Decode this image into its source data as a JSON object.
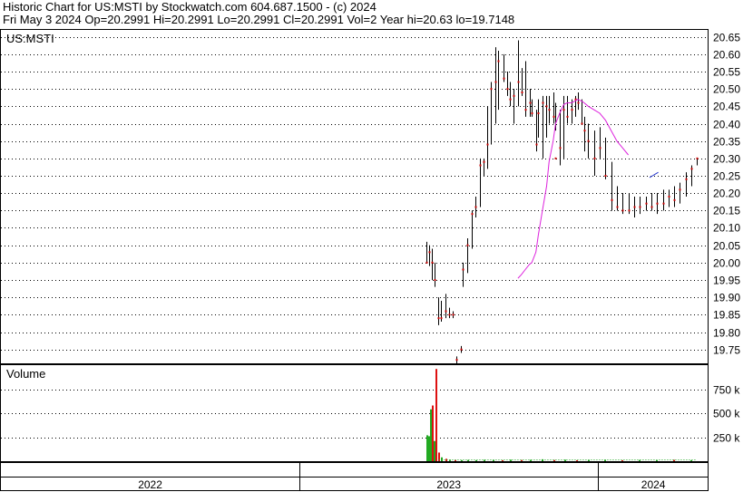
{
  "header": {
    "line1": "Historic Chart for US:MSTI by Stockwatch.com 604.687.1500 - (c) 2024",
    "line2": "Fri May  3 2024   Op=20.2991  Hi=20.2991  Lo=20.2991  Cl=20.2991  Vol=2  Year hi=20.63  lo=19.7148"
  },
  "colors": {
    "price_bar": "#000000",
    "close_dot": "#cc0000",
    "moving_average": "#dd22dd",
    "ma_tail": "#2233cc",
    "volume_up": "#22aa22",
    "volume_down": "#dd1111",
    "frame": "#000000"
  },
  "chart_data": [
    {
      "type": "ohlc",
      "title": "US:MSTI",
      "x": [
        "2023-06-05",
        "2023-06-08",
        "2023-06-12",
        "2023-06-15",
        "2023-06-20",
        "2023-06-23",
        "2023-06-28",
        "2023-07-03",
        "2023-07-07",
        "2023-07-12",
        "2023-07-17",
        "2023-07-20",
        "2023-07-25",
        "2023-07-31",
        "2023-08-04",
        "2023-08-09",
        "2023-08-14",
        "2023-08-18",
        "2023-08-23",
        "2023-08-28",
        "2023-09-01",
        "2023-09-07",
        "2023-09-12",
        "2023-09-15",
        "2023-09-20",
        "2023-09-25",
        "2023-09-29",
        "2023-10-04",
        "2023-10-09",
        "2023-10-12",
        "2023-10-17",
        "2023-10-20",
        "2023-10-25",
        "2023-10-30",
        "2023-11-02",
        "2023-11-07",
        "2023-11-10",
        "2023-11-15",
        "2023-11-20",
        "2023-11-24",
        "2023-11-29",
        "2023-12-04",
        "2023-12-07",
        "2023-12-12",
        "2023-12-15",
        "2023-12-20",
        "2023-12-27",
        "2024-01-03",
        "2024-01-10",
        "2024-01-17",
        "2024-01-24",
        "2024-01-31",
        "2024-02-07",
        "2024-02-14",
        "2024-02-21",
        "2024-02-28",
        "2024-03-06",
        "2024-03-13",
        "2024-03-20",
        "2024-03-27",
        "2024-04-03",
        "2024-04-10",
        "2024-04-17",
        "2024-04-24",
        "2024-05-01"
      ],
      "open": [
        20.0,
        20.04,
        20.03,
        19.95,
        19.88,
        19.85,
        19.88,
        19.85,
        19.85,
        19.72,
        19.75,
        19.95,
        19.98,
        20.05,
        20.14,
        20.17,
        20.27,
        20.28,
        20.35,
        20.45,
        20.52,
        20.58,
        20.52,
        20.48,
        20.45,
        20.5,
        20.52,
        20.45,
        20.46,
        20.44,
        20.35,
        20.4,
        20.42,
        20.44,
        20.46,
        20.44,
        20.42,
        20.3,
        20.33,
        20.45,
        20.42,
        20.44,
        20.47,
        20.45,
        20.4,
        20.38,
        20.34,
        20.35,
        20.32,
        20.25,
        20.18,
        20.15,
        20.16,
        20.15,
        20.16,
        20.16,
        20.17,
        20.16,
        20.18,
        20.17,
        20.19,
        20.2,
        20.22,
        20.25,
        20.3
      ],
      "high": [
        20.06,
        20.05,
        20.04,
        20.0,
        19.9,
        19.89,
        19.91,
        19.87,
        19.86,
        19.73,
        19.76,
        20.0,
        20.07,
        20.15,
        20.19,
        20.3,
        20.3,
        20.45,
        20.52,
        20.62,
        20.61,
        20.6,
        20.55,
        20.52,
        20.5,
        20.64,
        20.56,
        20.58,
        20.5,
        20.47,
        20.44,
        20.47,
        20.48,
        20.48,
        20.48,
        20.49,
        20.46,
        20.44,
        20.48,
        20.48,
        20.47,
        20.48,
        20.49,
        20.47,
        20.42,
        20.4,
        20.38,
        20.39,
        20.36,
        20.29,
        20.22,
        20.2,
        20.2,
        20.19,
        20.19,
        20.19,
        20.2,
        20.2,
        20.21,
        20.21,
        20.22,
        20.23,
        20.26,
        20.28,
        20.3
      ],
      "low": [
        20.0,
        19.99,
        19.95,
        19.93,
        19.82,
        19.83,
        19.84,
        19.84,
        19.84,
        19.71,
        19.74,
        19.93,
        19.97,
        20.04,
        20.13,
        20.16,
        20.25,
        20.27,
        20.34,
        20.4,
        20.44,
        20.52,
        20.48,
        20.45,
        20.4,
        20.45,
        20.48,
        20.42,
        20.42,
        20.42,
        20.32,
        20.36,
        20.3,
        20.36,
        20.4,
        20.4,
        20.38,
        20.28,
        20.3,
        20.4,
        20.4,
        20.42,
        20.44,
        20.4,
        20.32,
        20.3,
        20.25,
        20.3,
        20.24,
        20.15,
        20.15,
        20.14,
        20.14,
        20.13,
        20.14,
        20.15,
        20.15,
        20.14,
        20.15,
        20.16,
        20.16,
        20.17,
        20.19,
        20.22,
        20.28
      ],
      "close": [
        20.0,
        20.03,
        20.0,
        19.95,
        19.84,
        19.84,
        19.86,
        19.85,
        19.85,
        19.72,
        19.75,
        19.98,
        20.05,
        20.14,
        20.16,
        20.28,
        20.29,
        20.34,
        20.5,
        20.52,
        20.58,
        20.53,
        20.5,
        20.47,
        20.48,
        20.52,
        20.49,
        20.44,
        20.46,
        20.43,
        20.34,
        20.43,
        20.46,
        20.45,
        20.44,
        20.42,
        20.3,
        20.33,
        20.44,
        20.42,
        20.44,
        20.47,
        20.46,
        20.4,
        20.38,
        20.35,
        20.3,
        20.33,
        20.25,
        20.18,
        20.16,
        20.15,
        20.15,
        20.16,
        20.16,
        20.17,
        20.16,
        20.17,
        20.17,
        20.19,
        20.18,
        20.21,
        20.24,
        20.27,
        20.3
      ],
      "moving_average": [
        [
          25,
          19.955
        ],
        [
          26,
          19.965
        ],
        [
          27,
          19.98
        ],
        [
          28,
          19.995
        ],
        [
          29,
          20.0
        ],
        [
          30,
          20.03
        ],
        [
          31,
          20.08
        ],
        [
          32,
          20.15
        ],
        [
          33,
          20.22
        ],
        [
          34,
          20.29
        ],
        [
          35,
          20.35
        ],
        [
          36,
          20.4
        ],
        [
          37,
          20.43
        ],
        [
          38,
          20.455
        ],
        [
          39,
          20.46
        ],
        [
          40,
          20.46
        ],
        [
          41,
          20.465
        ],
        [
          42,
          20.47
        ],
        [
          43,
          20.465
        ],
        [
          44,
          20.46
        ],
        [
          45,
          20.45
        ],
        [
          46,
          20.44
        ],
        [
          47,
          20.43
        ],
        [
          48,
          20.41
        ],
        [
          49,
          20.38
        ],
        [
          50,
          20.35
        ],
        [
          51,
          20.33
        ],
        [
          52,
          20.31
        ]
      ],
      "ma_tail": [
        [
          52,
          20.245
        ],
        [
          53,
          20.25
        ],
        [
          54,
          20.255
        ],
        [
          55,
          20.26
        ]
      ],
      "ylim": [
        19.71,
        20.67
      ],
      "yticks": [
        "20.65",
        "20.60",
        "20.55",
        "20.50",
        "20.45",
        "20.40",
        "20.35",
        "20.30",
        "20.25",
        "20.20",
        "20.15",
        "20.10",
        "20.05",
        "20.00",
        "19.95",
        "19.90",
        "19.85",
        "19.80",
        "19.75"
      ],
      "grid": true
    },
    {
      "type": "bar",
      "title": "Volume",
      "ylim": [
        0,
        1000000
      ],
      "yticks": [
        "750 k",
        "500 k",
        "250 k"
      ],
      "bars": [
        {
          "x": "2023-06-05",
          "v": 270000,
          "dir": "up"
        },
        {
          "x": "2023-06-07",
          "v": 260000,
          "dir": "up"
        },
        {
          "x": "2023-06-09",
          "v": 540000,
          "dir": "up"
        },
        {
          "x": "2023-06-12",
          "v": 580000,
          "dir": "down"
        },
        {
          "x": "2023-06-14",
          "v": 210000,
          "dir": "up"
        },
        {
          "x": "2023-06-16",
          "v": 960000,
          "dir": "down"
        },
        {
          "x": "2023-06-20",
          "v": 90000,
          "dir": "down"
        },
        {
          "x": "2023-06-23",
          "v": 40000,
          "dir": "up"
        },
        {
          "x": "2023-06-28",
          "v": 25000,
          "dir": "down"
        },
        {
          "x": "2023-07-03",
          "v": 15000,
          "dir": "up"
        },
        {
          "x": "2023-07-10",
          "v": 12000,
          "dir": "down"
        },
        {
          "x": "2023-07-17",
          "v": 10000,
          "dir": "up"
        },
        {
          "x": "2023-07-25",
          "v": 12000,
          "dir": "up"
        },
        {
          "x": "2023-08-04",
          "v": 10000,
          "dir": "up"
        },
        {
          "x": "2023-08-14",
          "v": 14000,
          "dir": "up"
        },
        {
          "x": "2023-08-25",
          "v": 12000,
          "dir": "up"
        },
        {
          "x": "2023-09-05",
          "v": 10000,
          "dir": "down"
        },
        {
          "x": "2023-09-15",
          "v": 15000,
          "dir": "up"
        },
        {
          "x": "2023-09-28",
          "v": 12000,
          "dir": "down"
        },
        {
          "x": "2023-10-10",
          "v": 14000,
          "dir": "up"
        },
        {
          "x": "2023-10-24",
          "v": 20000,
          "dir": "up"
        },
        {
          "x": "2023-11-07",
          "v": 12000,
          "dir": "down"
        },
        {
          "x": "2023-11-21",
          "v": 15000,
          "dir": "up"
        },
        {
          "x": "2023-12-05",
          "v": 10000,
          "dir": "down"
        },
        {
          "x": "2023-12-19",
          "v": 12000,
          "dir": "up"
        },
        {
          "x": "2024-01-09",
          "v": 14000,
          "dir": "up"
        },
        {
          "x": "2024-01-30",
          "v": 10000,
          "dir": "down"
        },
        {
          "x": "2024-02-20",
          "v": 12000,
          "dir": "up"
        },
        {
          "x": "2024-03-12",
          "v": 10000,
          "dir": "up"
        },
        {
          "x": "2024-04-02",
          "v": 14000,
          "dir": "down"
        },
        {
          "x": "2024-04-23",
          "v": 10000,
          "dir": "up"
        }
      ]
    }
  ],
  "time_axis": {
    "years": [
      "2022",
      "2023",
      "2024"
    ]
  }
}
